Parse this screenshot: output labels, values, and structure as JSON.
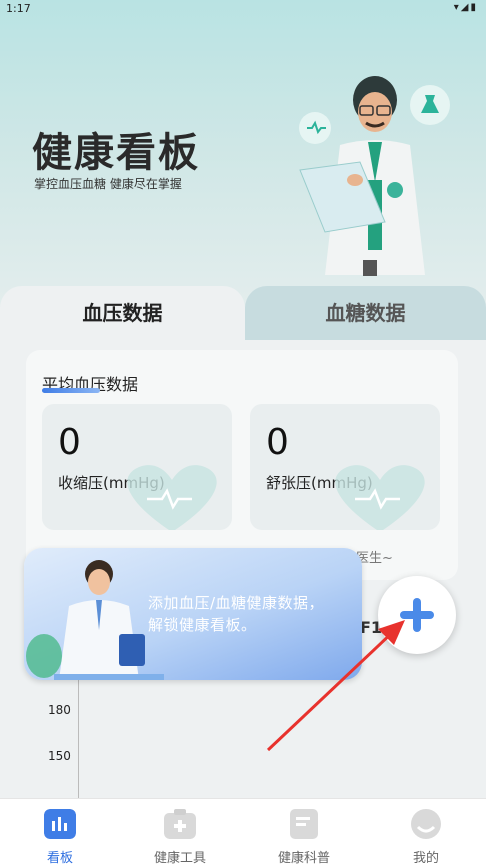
{
  "status_bar": {
    "time": "1:17"
  },
  "hero": {
    "title": "健康看板",
    "subtitle": "掌控血压血糖 健康尽在掌握"
  },
  "tabs": [
    {
      "label": "血压数据",
      "active": true
    },
    {
      "label": "血糖数据",
      "active": false
    }
  ],
  "avg_card": {
    "title": "平均血压数据",
    "systolic": {
      "value": "0",
      "label": "收缩压(mmHg)"
    },
    "diastolic": {
      "value": "0",
      "label": "舒张压(mmHg)"
    },
    "consult_text": "咨询医生~"
  },
  "chart": {
    "partial_title": "F1",
    "y_ticks": [
      "180",
      "150"
    ]
  },
  "overlay": {
    "message": "添加血压/血糖健康数据，解锁健康看板。"
  },
  "add_button": {
    "icon": "plus-icon"
  },
  "colors": {
    "accent": "#2f6fe0",
    "arrow": "#e8322d"
  },
  "bottom_nav": [
    {
      "label": "看板",
      "icon": "dashboard-icon",
      "active": true
    },
    {
      "label": "健康工具",
      "icon": "medkit-icon",
      "active": false
    },
    {
      "label": "健康科普",
      "icon": "article-icon",
      "active": false
    },
    {
      "label": "我的",
      "icon": "profile-icon",
      "active": false
    }
  ]
}
